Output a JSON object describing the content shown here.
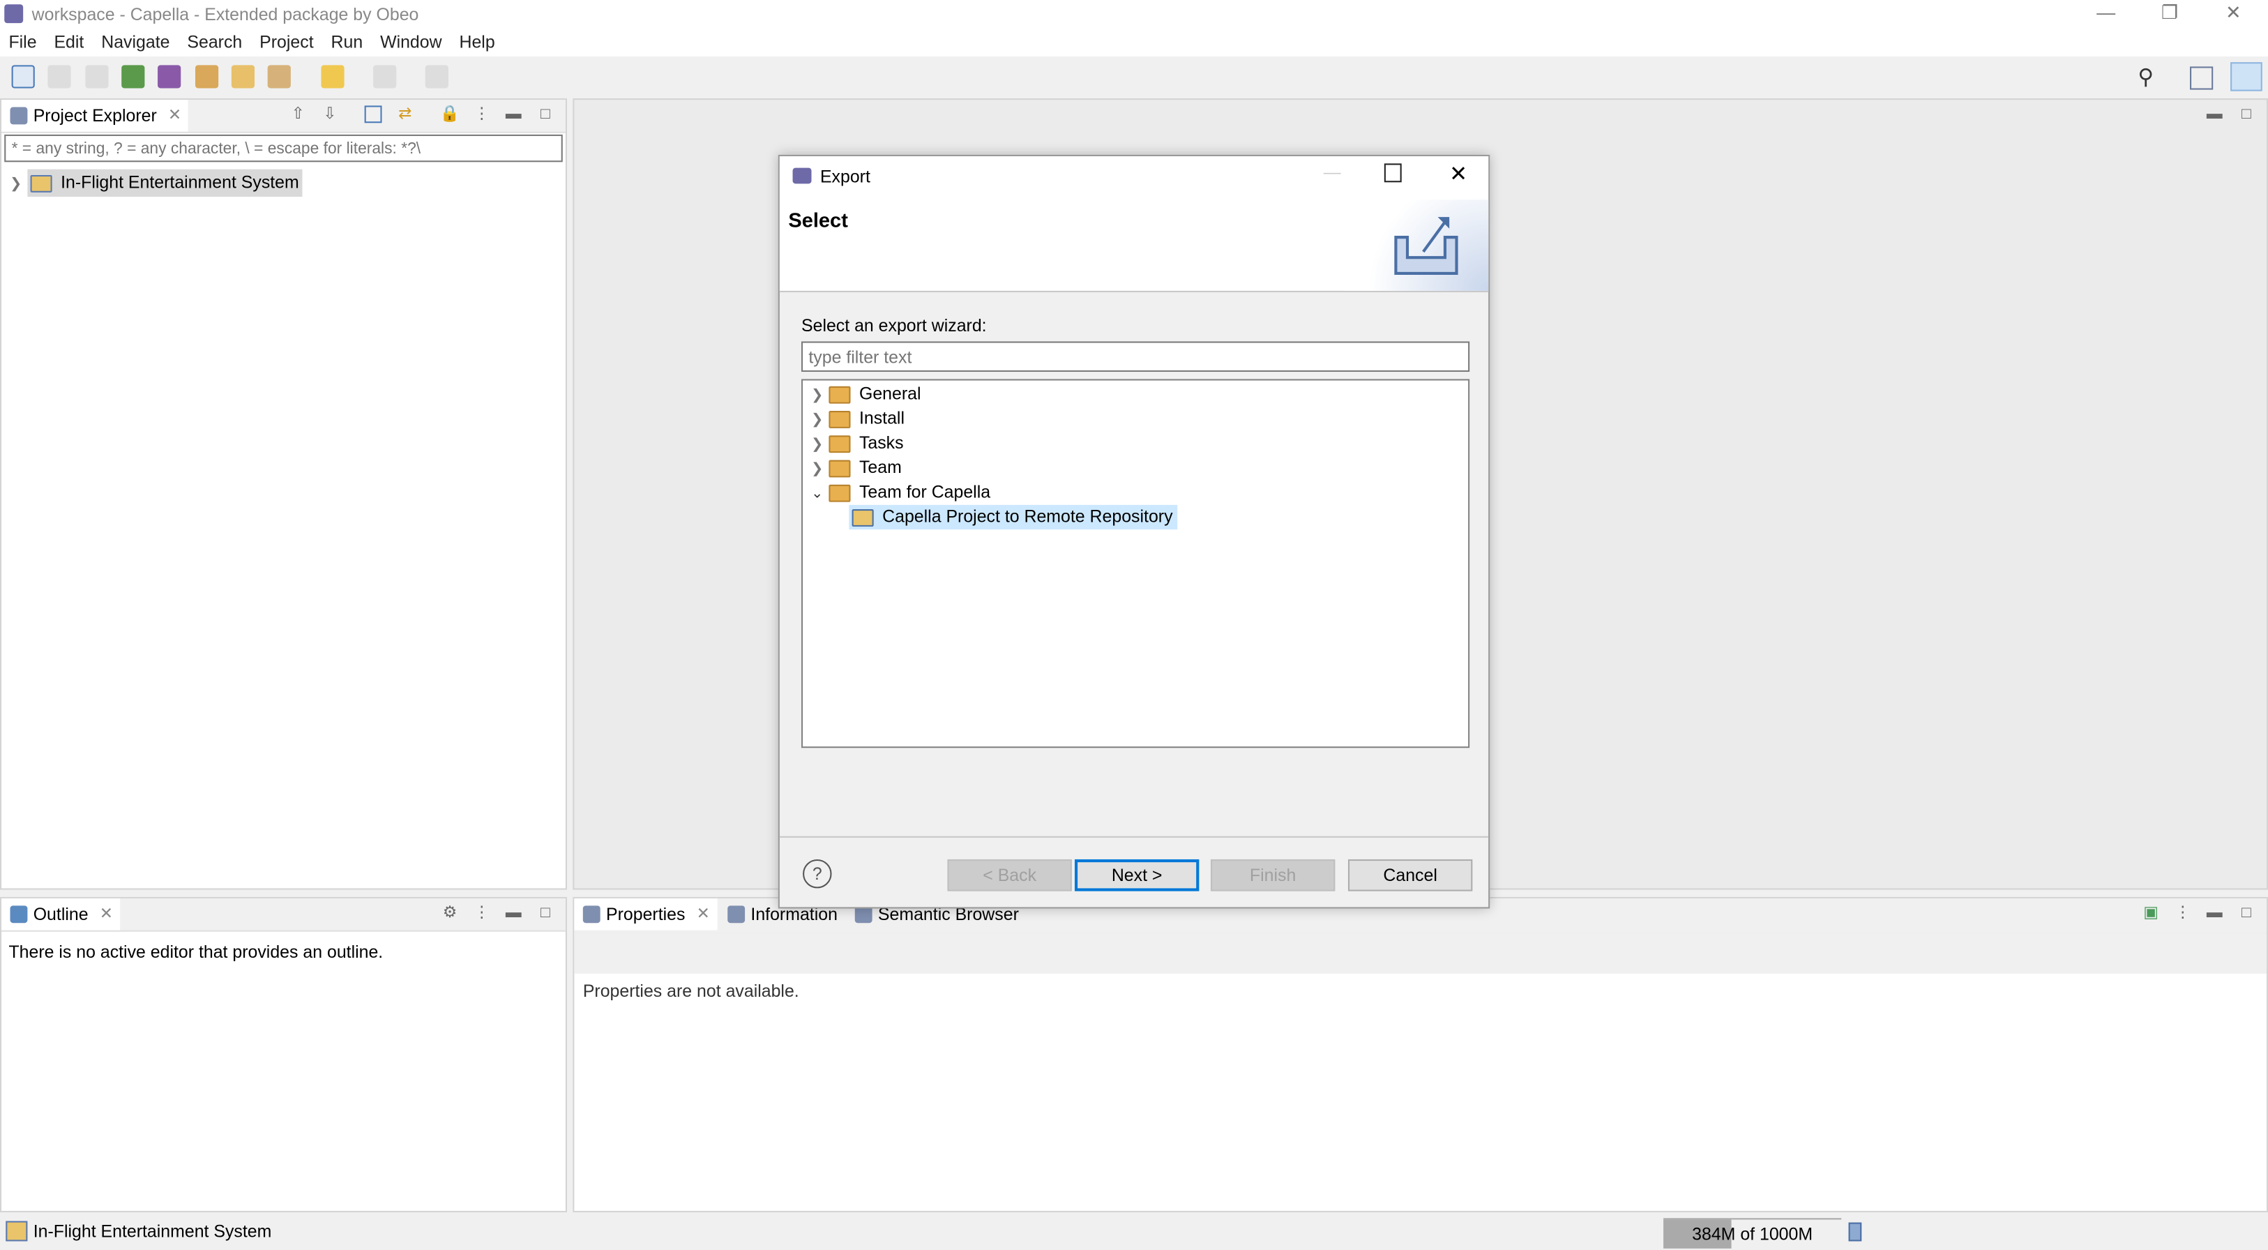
{
  "window": {
    "title": "workspace - Capella - Extended package by Obeo"
  },
  "menu": [
    "File",
    "Edit",
    "Navigate",
    "Search",
    "Project",
    "Run",
    "Window",
    "Help"
  ],
  "project_explorer": {
    "tab": "Project Explorer",
    "filter_placeholder": "* = any string, ? = any character, \\ = escape for literals: *?\\",
    "items": [
      {
        "label": "In-Flight Entertainment System",
        "expanded": false,
        "selected": true
      }
    ]
  },
  "outline": {
    "tab": "Outline",
    "message": "There is no active editor that provides an outline."
  },
  "bottom_tabs": {
    "properties": "Properties",
    "information": "Information",
    "semantic_browser": "Semantic Browser",
    "message": "Properties are not available."
  },
  "status": {
    "selection": "In-Flight Entertainment System",
    "memory_text": "384M of 1000M",
    "memory_used_fraction": 0.384
  },
  "dialog": {
    "title": "Export",
    "heading": "Select",
    "label": "Select an export wizard:",
    "filter_placeholder": "type filter text",
    "tree": [
      {
        "label": "General",
        "expanded": false
      },
      {
        "label": "Install",
        "expanded": false
      },
      {
        "label": "Tasks",
        "expanded": false
      },
      {
        "label": "Team",
        "expanded": false
      },
      {
        "label": "Team for Capella",
        "expanded": true,
        "children": [
          {
            "label": "Capella Project to Remote Repository",
            "selected": true
          }
        ]
      }
    ],
    "buttons": {
      "back": "< Back",
      "next": "Next >",
      "finish": "Finish",
      "cancel": "Cancel"
    }
  },
  "colors": {
    "selection": "#cce8ff",
    "accent": "#0078d7",
    "folder": "#e8b04e"
  }
}
